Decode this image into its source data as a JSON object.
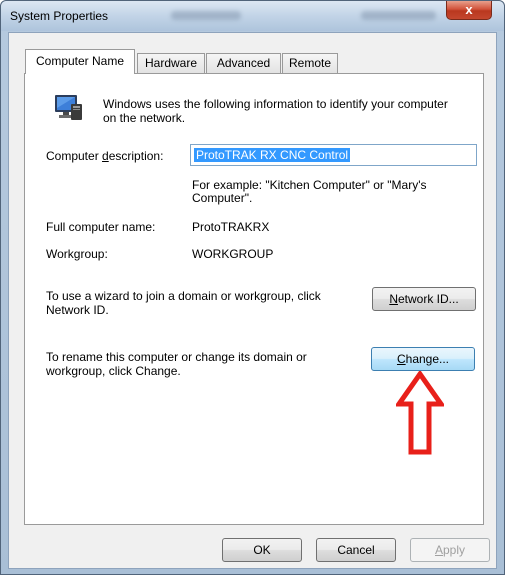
{
  "window": {
    "title": "System Properties",
    "close_label": "x"
  },
  "tabs": [
    {
      "label": "Computer Name"
    },
    {
      "label": "Hardware"
    },
    {
      "label": "Advanced"
    },
    {
      "label": "Remote"
    }
  ],
  "intro": {
    "icon": "computer-monitor-icon",
    "line1": "Windows uses the following information to identify your computer",
    "line2": "on the network."
  },
  "description": {
    "label_pre": "Computer ",
    "label_underlined": "d",
    "label_post": "escription:",
    "value": "ProtoTRAK RX CNC Control",
    "example_line1": "For example: \"Kitchen Computer\" or \"Mary's",
    "example_line2": "Computer\"."
  },
  "full_name": {
    "label": "Full computer name:",
    "value": "ProtoTRAKRX"
  },
  "workgroup": {
    "label": "Workgroup:",
    "value": "WORKGROUP"
  },
  "network_id": {
    "text_line1": "To use a wizard to join a domain or workgroup, click",
    "text_line2": "Network ID.",
    "button_underlined": "N",
    "button_rest": "etwork ID..."
  },
  "change": {
    "text_line1": "To rename this computer or change its domain or",
    "text_line2": "workgroup, click Change.",
    "button_underlined": "C",
    "button_rest": "hange..."
  },
  "annotation": {
    "arrow_icon": "red-up-arrow-icon",
    "arrow_color": "#e8201a"
  },
  "footer": {
    "ok_label": "OK",
    "cancel_label": "Cancel",
    "apply_underlined": "A",
    "apply_rest": "pply"
  }
}
